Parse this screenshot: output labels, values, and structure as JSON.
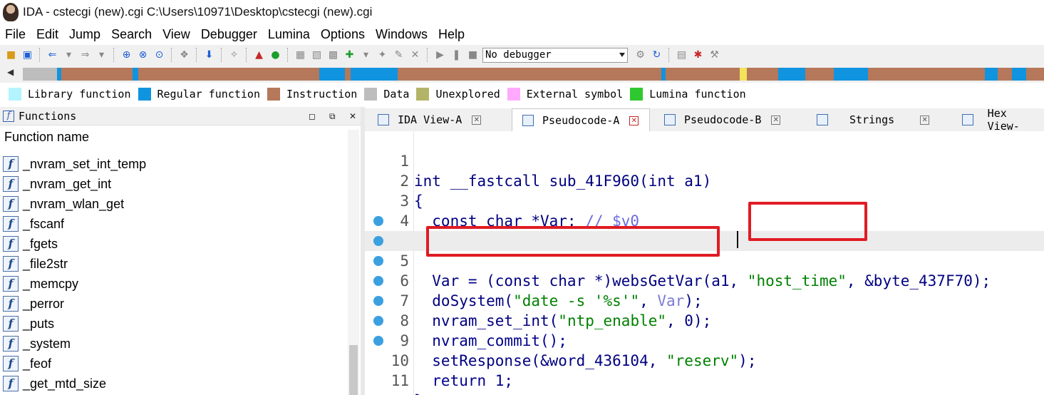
{
  "window": {
    "title": "IDA - cstecgi (new).cgi C:\\Users\\10971\\Desktop\\cstecgi (new).cgi"
  },
  "menu": {
    "items": [
      "File",
      "Edit",
      "Jump",
      "Search",
      "View",
      "Debugger",
      "Lumina",
      "Options",
      "Windows",
      "Help"
    ]
  },
  "toolbar": {
    "debugger_select": "No debugger",
    "icons": [
      "open-file-icon",
      "save-icon",
      "back-arrow-icon",
      "forward-arrow-icon",
      "run-icon",
      "pause-icon",
      "stop-icon"
    ]
  },
  "legend": {
    "items": [
      {
        "label": "Library function",
        "color": "#b3f4ff"
      },
      {
        "label": "Regular function",
        "color": "#1094e0"
      },
      {
        "label": "Instruction",
        "color": "#b5785a"
      },
      {
        "label": "Data",
        "color": "#bdbdbd"
      },
      {
        "label": "Unexplored",
        "color": "#b4b468"
      },
      {
        "label": "External symbol",
        "color": "#ffaaff"
      },
      {
        "label": "Lumina function",
        "color": "#30c830"
      }
    ]
  },
  "functions_panel": {
    "title": "Functions",
    "column_header": "Function name",
    "functions": [
      "_nvram_set_int_temp",
      "_nvram_get_int",
      "_nvram_wlan_get",
      "_fscanf",
      "_fgets",
      "_file2str",
      "_memcpy",
      "_perror",
      "_puts",
      "_system",
      "_feof",
      "_get_mtd_size"
    ]
  },
  "tabs": [
    {
      "label": "IDA View-A",
      "active": false
    },
    {
      "label": "Pseudocode-A",
      "active": true
    },
    {
      "label": "Pseudocode-B",
      "active": false
    },
    {
      "label": "Strings",
      "active": false
    },
    {
      "label": "Hex View-",
      "active": false
    }
  ],
  "code": {
    "lines": [
      {
        "n": "1",
        "text": "int __fastcall sub_41F960(int a1)",
        "bp": false
      },
      {
        "n": "2",
        "text": "{",
        "bp": false
      },
      {
        "n": "3",
        "text": "  const char *Var; // $v0",
        "bp": false
      },
      {
        "n": "4",
        "text": "",
        "bp": false
      },
      {
        "n": "5",
        "text": "  Var = (const char *)websGetVar(a1, \"host_time\", &byte_437F70);",
        "bp": true
      },
      {
        "n": "6",
        "text": "  doSystem(\"date -s '%s'\", Var);",
        "bp": true
      },
      {
        "n": "7",
        "text": "  nvram_set_int(\"ntp_enable\", 0);",
        "bp": true
      },
      {
        "n": "8",
        "text": "  nvram_commit();",
        "bp": true
      },
      {
        "n": "9",
        "text": "  setResponse(&word_436104, \"reserv\");",
        "bp": true
      },
      {
        "n": "10",
        "text": "  return 1;",
        "bp": true
      },
      {
        "n": "11",
        "text": "}",
        "bp": true
      }
    ],
    "segments": {
      "l1_kw": "int __fastcall sub_41F960(int a1)",
      "l3_kw": "  const char *Var; ",
      "l3_cmt": "// $v0",
      "l5_a": "  Var = (const char *)websGetVar(a1, ",
      "l5_str": "\"host_time\"",
      "l5_b": ", &byte_437F70);",
      "l6_fn": "  doSystem(",
      "l6_str": "\"date -s '%s'\"",
      "l6_sep": ", ",
      "l6_var": "Var",
      "l6_end": ");",
      "l7_a": "  nvram_set_int(",
      "l7_str": "\"ntp_enable\"",
      "l7_b": ", 0);",
      "l8": "  nvram_commit();",
      "l9_a": "  setResponse(&word_436104, ",
      "l9_str": "\"reserv\"",
      "l9_b": ");",
      "l10": "  return 1;"
    }
  },
  "colors": {
    "highlight_box": "#e01b24",
    "breakpoint": "#3aa0e0",
    "current_line": "#ececec"
  }
}
